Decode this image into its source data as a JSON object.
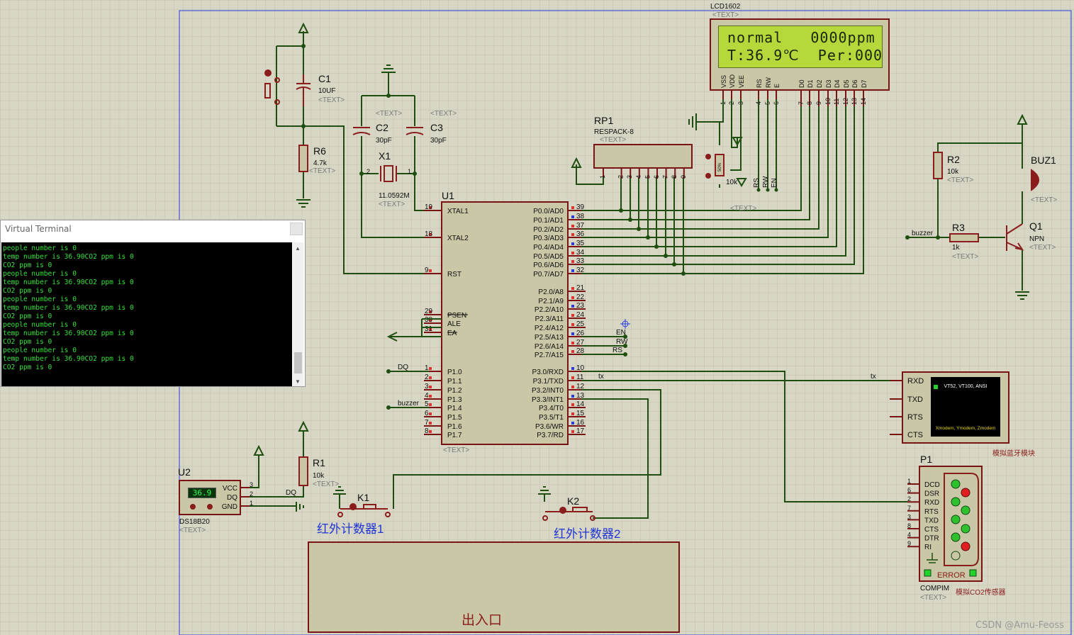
{
  "terminal": {
    "title": "Virtual Terminal",
    "lines": [
      "people number is 0",
      "temp number is 36.90CO2 ppm is 0",
      "CO2 ppm is 0",
      "people number is 0",
      "temp number is 36.90CO2 ppm is 0",
      "CO2 ppm is 0",
      "people number is 0",
      "temp number is 36.90CO2 ppm is 0",
      "CO2 ppm is 0",
      "people number is 0",
      "temp number is 36.90CO2 ppm is 0",
      "CO2 ppm is 0",
      "people number is 0",
      "temp number is 36.90CO2 ppm is 0",
      "CO2 ppm is 0"
    ]
  },
  "lcd": {
    "ref": "LCD1602",
    "text_tag": "<TEXT>",
    "line1": "normal   0000ppm",
    "line2": "T:36.9℃  Per:000",
    "pins": [
      "VSS",
      "VDD",
      "VEE",
      "RS",
      "RW",
      "E",
      "D0",
      "D1",
      "D2",
      "D3",
      "D4",
      "D5",
      "D6",
      "D7"
    ],
    "pin_numbers": [
      "1",
      "2",
      "3",
      "4",
      "5",
      "6",
      "7",
      "8",
      "9",
      "10",
      "11",
      "12",
      "13",
      "14"
    ]
  },
  "mcu": {
    "ref": "U1",
    "text_tag": "<TEXT>",
    "left_pins": [
      {
        "num": "19",
        "name": "XTAL1"
      },
      {
        "num": "18",
        "name": "XTAL2"
      },
      {
        "num": "9",
        "name": "RST"
      },
      {
        "num": "29",
        "name": "PSEN"
      },
      {
        "num": "30",
        "name": "ALE"
      },
      {
        "num": "31",
        "name": "EA"
      },
      {
        "num": "1",
        "name": "P1.0"
      },
      {
        "num": "2",
        "name": "P1.1"
      },
      {
        "num": "3",
        "name": "P1.2"
      },
      {
        "num": "4",
        "name": "P1.3"
      },
      {
        "num": "5",
        "name": "P1.4"
      },
      {
        "num": "6",
        "name": "P1.5"
      },
      {
        "num": "7",
        "name": "P1.6"
      },
      {
        "num": "8",
        "name": "P1.7"
      }
    ],
    "right_pins": [
      {
        "num": "39",
        "name": "P0.0/AD0"
      },
      {
        "num": "38",
        "name": "P0.1/AD1"
      },
      {
        "num": "37",
        "name": "P0.2/AD2"
      },
      {
        "num": "36",
        "name": "P0.3/AD3"
      },
      {
        "num": "35",
        "name": "P0.4/AD4"
      },
      {
        "num": "34",
        "name": "P0.5/AD5"
      },
      {
        "num": "33",
        "name": "P0.6/AD6"
      },
      {
        "num": "32",
        "name": "P0.7/AD7"
      },
      {
        "num": "21",
        "name": "P2.0/A8"
      },
      {
        "num": "22",
        "name": "P2.1/A9"
      },
      {
        "num": "23",
        "name": "P2.2/A10"
      },
      {
        "num": "24",
        "name": "P2.3/A11"
      },
      {
        "num": "25",
        "name": "P2.4/A12"
      },
      {
        "num": "26",
        "name": "P2.5/A13"
      },
      {
        "num": "27",
        "name": "P2.6/A14"
      },
      {
        "num": "28",
        "name": "P2.7/A15"
      },
      {
        "num": "10",
        "name": "P3.0/RXD"
      },
      {
        "num": "11",
        "name": "P3.1/TXD"
      },
      {
        "num": "12",
        "name": "P3.2/INT0"
      },
      {
        "num": "13",
        "name": "P3.3/INT1"
      },
      {
        "num": "14",
        "name": "P3.4/T0"
      },
      {
        "num": "15",
        "name": "P3.5/T1"
      },
      {
        "num": "16",
        "name": "P3.6/WR"
      },
      {
        "num": "17",
        "name": "P3.7/RD"
      }
    ]
  },
  "components": {
    "c1": {
      "ref": "C1",
      "value": "10UF",
      "tag": "<TEXT>"
    },
    "c2": {
      "ref": "C2",
      "value": "30pF",
      "tag": "<TEXT>"
    },
    "c3": {
      "ref": "C3",
      "value": "30pF",
      "tag": "<TEXT>"
    },
    "r6": {
      "ref": "R6",
      "value": "4.7k",
      "tag": "<TEXT>"
    },
    "x1": {
      "ref": "X1",
      "value": "11.0592M",
      "tag": "<TEXT>",
      "pin1": "1",
      "pin2": "2"
    },
    "rp1": {
      "ref": "RP1",
      "value": "RESPACK-8",
      "tag": "<TEXT>",
      "pins": [
        "1",
        "2",
        "3",
        "4",
        "5",
        "6",
        "7",
        "8",
        "9"
      ]
    },
    "pot": {
      "value": "10k",
      "tag": "<TEXT>",
      "mark": "50%"
    },
    "r2": {
      "ref": "R2",
      "value": "10k",
      "tag": "<TEXT>"
    },
    "r3": {
      "ref": "R3",
      "value": "1k",
      "tag": "<TEXT>"
    },
    "q1": {
      "ref": "Q1",
      "value": "NPN",
      "tag": "<TEXT>"
    },
    "buz1": {
      "ref": "BUZ1",
      "tag": "<TEXT>"
    },
    "r1": {
      "ref": "R1",
      "value": "10k",
      "tag": "<TEXT>"
    },
    "u2": {
      "ref": "U2",
      "value": "DS18B20",
      "tag": "<TEXT>",
      "display": "36.9",
      "pins": [
        "VCC",
        "DQ",
        "GND"
      ],
      "pin_nums": [
        "3",
        "2",
        "1"
      ]
    },
    "k1": {
      "ref": "K1",
      "label": "红外计数器1"
    },
    "k2": {
      "ref": "K2",
      "label": "红外计数器2"
    },
    "bt": {
      "pins": [
        "RXD",
        "TXD",
        "RTS",
        "CTS"
      ],
      "screen_title": "VT52, VT100, ANSI",
      "screen_sub": "Xmodem, Ymodem, Zmodem",
      "label": "模拟蓝牙模块"
    },
    "p1": {
      "ref": "P1",
      "value": "COMPIM",
      "tag": "<TEXT>",
      "pins": [
        "DCD",
        "DSR",
        "RXD",
        "RTS",
        "TXD",
        "CTS",
        "DTR",
        "RI"
      ],
      "pin_nums": [
        "1",
        "6",
        "2",
        "7",
        "3",
        "8",
        "4",
        "9"
      ],
      "error": "ERROR",
      "label": "模拟CO2传感器"
    }
  },
  "nets": {
    "dq": "DQ",
    "buzzer": "buzzer",
    "tx": "tx",
    "en": "EN",
    "rw": "RW",
    "rs": "RS"
  },
  "entrance": {
    "label": "出入口"
  },
  "watermark": "CSDN @Amu-Feoss",
  "colors": {
    "wire": "#1f4f10",
    "body": "#c9c7a5",
    "outline": "#7a1414",
    "label": "#0f0f0f",
    "pin_red": "#e03030",
    "pin_blue": "#2b3de0",
    "text_tag": "#7a7a7a",
    "blue_text": "#1f35d6"
  }
}
